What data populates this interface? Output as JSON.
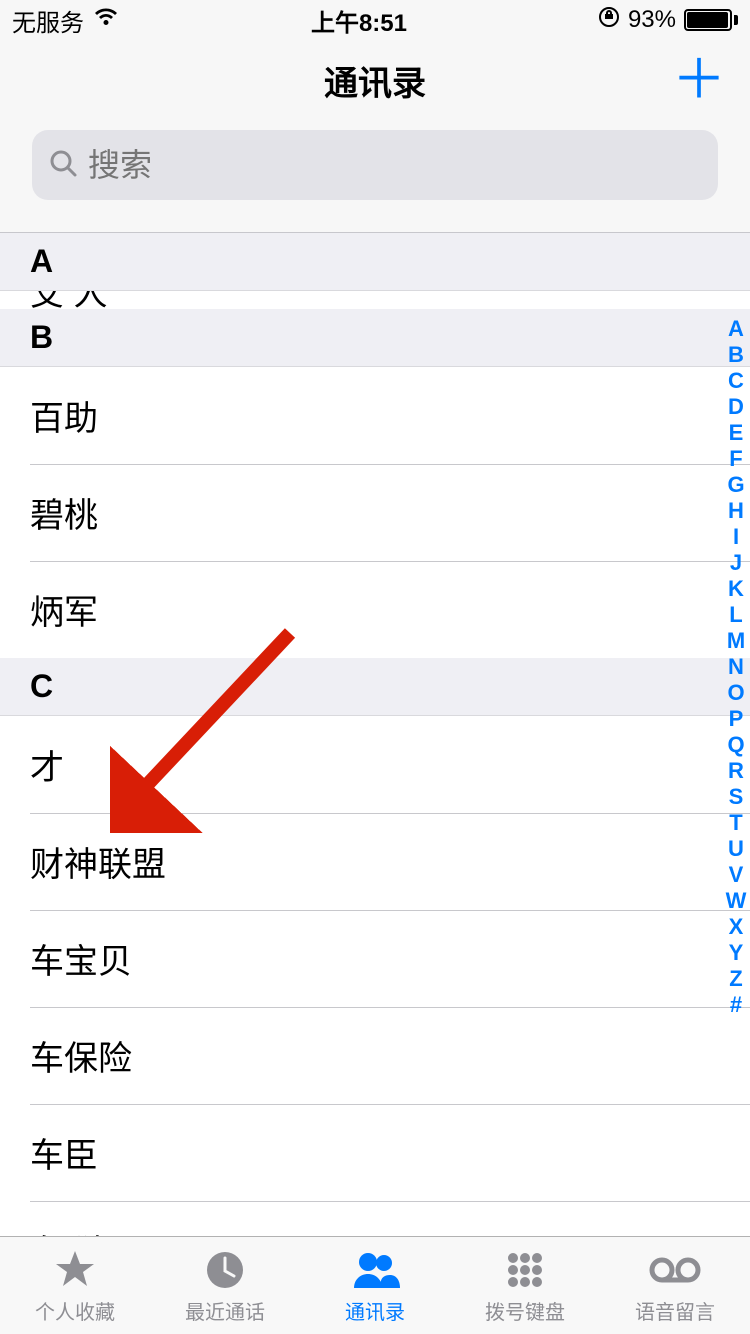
{
  "status": {
    "carrier": "无服务",
    "time": "上午8:51",
    "battery_pct": "93%"
  },
  "nav": {
    "title": "通讯录"
  },
  "search": {
    "placeholder": "搜索"
  },
  "sections": [
    {
      "letter": "A",
      "peek": ""
    },
    {
      "letter": "B",
      "rows": [
        "百助",
        "碧桃",
        "炳军"
      ]
    },
    {
      "letter": "C",
      "rows": [
        "才",
        "财神联盟",
        "车宝贝",
        "车保险",
        "车臣",
        "车(独)"
      ]
    }
  ],
  "index": [
    "A",
    "B",
    "C",
    "D",
    "E",
    "F",
    "G",
    "H",
    "I",
    "J",
    "K",
    "L",
    "M",
    "N",
    "O",
    "P",
    "Q",
    "R",
    "S",
    "T",
    "U",
    "V",
    "W",
    "X",
    "Y",
    "Z",
    "#"
  ],
  "tabs": [
    {
      "label": "个人收藏",
      "icon": "star-icon"
    },
    {
      "label": "最近通话",
      "icon": "clock-icon"
    },
    {
      "label": "通讯录",
      "icon": "contacts-icon",
      "active": true
    },
    {
      "label": "拨号键盘",
      "icon": "keypad-icon"
    },
    {
      "label": "语音留言",
      "icon": "voicemail-icon"
    }
  ]
}
